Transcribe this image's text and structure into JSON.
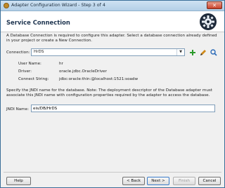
{
  "window": {
    "title": "Adapter Configuration Wizard - Step 3 of 4",
    "close_glyph": "✕"
  },
  "header": {
    "title": "Service Connection",
    "logo_icon": "gear-icon"
  },
  "intro_text": "A Database Connection is required to configure this adapter. Select a database connection already defined in your project or create a New Connection.",
  "connection": {
    "label": "Connection:",
    "value": "HrDS",
    "dropdown_glyph": "▼"
  },
  "toolbar_icons": [
    "add-icon",
    "edit-icon",
    "search-icon"
  ],
  "details": [
    {
      "label": "User Name:",
      "value": "hr"
    },
    {
      "label": "Driver:",
      "value": "oracle.jdbc.OracleDriver"
    },
    {
      "label": "Connect String:",
      "value": "jdbc:oracle:thin:@localhost:1521:soadw"
    }
  ],
  "jndi_text": "Specify the JNDI name for the database.  Note: The deployment descriptor of the Database adapter must associate this JNDI name with configuration properties required by the adapter to access the database.",
  "jndi": {
    "label": "JNDI Name:",
    "value": "eis/DB/HrDS"
  },
  "buttons": {
    "help": "Help",
    "back": "< Back",
    "next": "Next >",
    "finish": "Finish",
    "cancel": "Cancel"
  },
  "colors": {
    "add": "#2a9a2a",
    "edit": "#d08a1a",
    "search": "#2a6ab8"
  }
}
